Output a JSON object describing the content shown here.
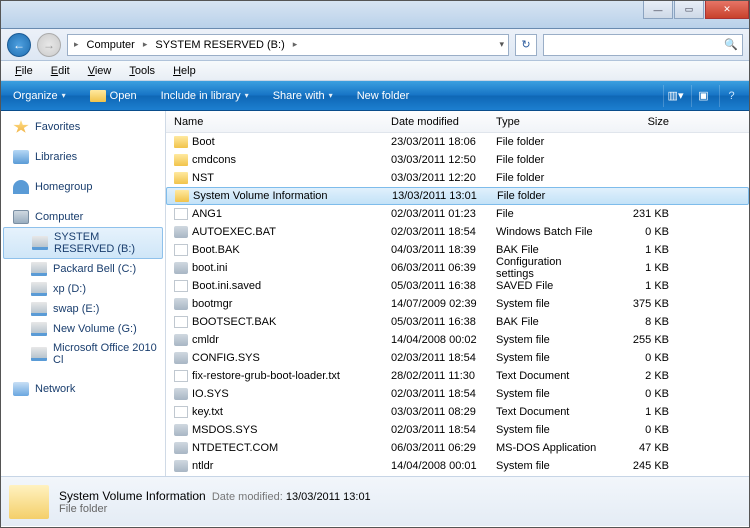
{
  "breadcrumbs": [
    "Computer",
    "SYSTEM RESERVED (B:)"
  ],
  "menus": {
    "file": "File",
    "edit": "Edit",
    "view": "View",
    "tools": "Tools",
    "help": "Help"
  },
  "toolbar": {
    "organize": "Organize",
    "open": "Open",
    "include": "Include in library",
    "share": "Share with",
    "newfolder": "New folder"
  },
  "columns": {
    "name": "Name",
    "date": "Date modified",
    "type": "Type",
    "size": "Size"
  },
  "sidebar": {
    "favorites": "Favorites",
    "libraries": "Libraries",
    "homegroup": "Homegroup",
    "computer": "Computer",
    "network": "Network",
    "drives": [
      "SYSTEM RESERVED (B:)",
      "Packard Bell (C:)",
      "xp (D:)",
      "swap (E:)",
      "New Volume (G:)",
      "Microsoft Office 2010 Cl"
    ]
  },
  "files": [
    {
      "name": "Boot",
      "date": "23/03/2011 18:06",
      "type": "File folder",
      "size": "",
      "kind": "fold"
    },
    {
      "name": "cmdcons",
      "date": "03/03/2011 12:50",
      "type": "File folder",
      "size": "",
      "kind": "fold"
    },
    {
      "name": "NST",
      "date": "03/03/2011 12:20",
      "type": "File folder",
      "size": "",
      "kind": "fold"
    },
    {
      "name": "System Volume Information",
      "date": "13/03/2011 13:01",
      "type": "File folder",
      "size": "",
      "kind": "fold",
      "selected": true
    },
    {
      "name": "ANG1",
      "date": "02/03/2011 01:23",
      "type": "File",
      "size": "231 KB",
      "kind": "file"
    },
    {
      "name": "AUTOEXEC.BAT",
      "date": "02/03/2011 18:54",
      "type": "Windows Batch File",
      "size": "0 KB",
      "kind": "gear"
    },
    {
      "name": "Boot.BAK",
      "date": "04/03/2011 18:39",
      "type": "BAK File",
      "size": "1 KB",
      "kind": "file"
    },
    {
      "name": "boot.ini",
      "date": "06/03/2011 06:39",
      "type": "Configuration settings",
      "size": "1 KB",
      "kind": "gear"
    },
    {
      "name": "Boot.ini.saved",
      "date": "05/03/2011 16:38",
      "type": "SAVED File",
      "size": "1 KB",
      "kind": "file"
    },
    {
      "name": "bootmgr",
      "date": "14/07/2009 02:39",
      "type": "System file",
      "size": "375 KB",
      "kind": "gear"
    },
    {
      "name": "BOOTSECT.BAK",
      "date": "05/03/2011 16:38",
      "type": "BAK File",
      "size": "8 KB",
      "kind": "file"
    },
    {
      "name": "cmldr",
      "date": "14/04/2008 00:02",
      "type": "System file",
      "size": "255 KB",
      "kind": "gear"
    },
    {
      "name": "CONFIG.SYS",
      "date": "02/03/2011 18:54",
      "type": "System file",
      "size": "0 KB",
      "kind": "gear"
    },
    {
      "name": "fix-restore-grub-boot-loader.txt",
      "date": "28/02/2011 11:30",
      "type": "Text Document",
      "size": "2 KB",
      "kind": "file"
    },
    {
      "name": "IO.SYS",
      "date": "02/03/2011 18:54",
      "type": "System file",
      "size": "0 KB",
      "kind": "gear"
    },
    {
      "name": "key.txt",
      "date": "03/03/2011 08:29",
      "type": "Text Document",
      "size": "1 KB",
      "kind": "file"
    },
    {
      "name": "MSDOS.SYS",
      "date": "02/03/2011 18:54",
      "type": "System file",
      "size": "0 KB",
      "kind": "gear"
    },
    {
      "name": "NTDETECT.COM",
      "date": "06/03/2011 06:29",
      "type": "MS-DOS Application",
      "size": "47 KB",
      "kind": "gear"
    },
    {
      "name": "ntldr",
      "date": "14/04/2008 00:01",
      "type": "System file",
      "size": "245 KB",
      "kind": "gear"
    }
  ],
  "detail": {
    "title": "System Volume Information",
    "datelabel": "Date modified:",
    "date": "13/03/2011 13:01",
    "type": "File folder"
  }
}
